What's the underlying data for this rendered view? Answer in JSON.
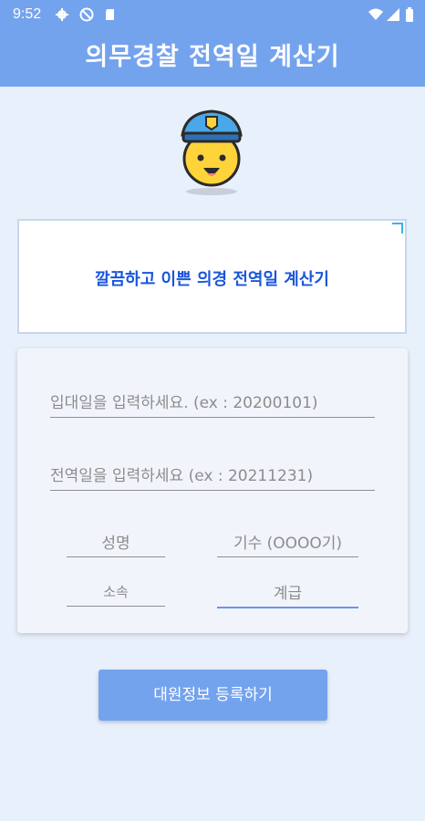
{
  "status": {
    "time": "9:52",
    "icons": [
      "gear-icon",
      "do-not-disturb-icon",
      "sd-card-icon",
      "wifi-icon",
      "signal-icon",
      "battery-icon"
    ]
  },
  "app": {
    "title": "의무경찰 전역일 계산기"
  },
  "ad": {
    "text": "깔끔하고 이쁜 의경 전역일 계산기"
  },
  "form": {
    "enlist_placeholder": "입대일을 입력하세요. (ex : 20200101)",
    "discharge_placeholder": "전역일을 입력하세요 (ex : 20211231)",
    "name_placeholder": "성명",
    "class_placeholder": "기수 (OOOO기)",
    "unit_placeholder": "소속",
    "rank_placeholder": "계급"
  },
  "submit_label": "대원정보 등록하기",
  "colors": {
    "primary": "#74a3ee",
    "background": "#e8f0fc",
    "ad_text": "#1a56db"
  }
}
